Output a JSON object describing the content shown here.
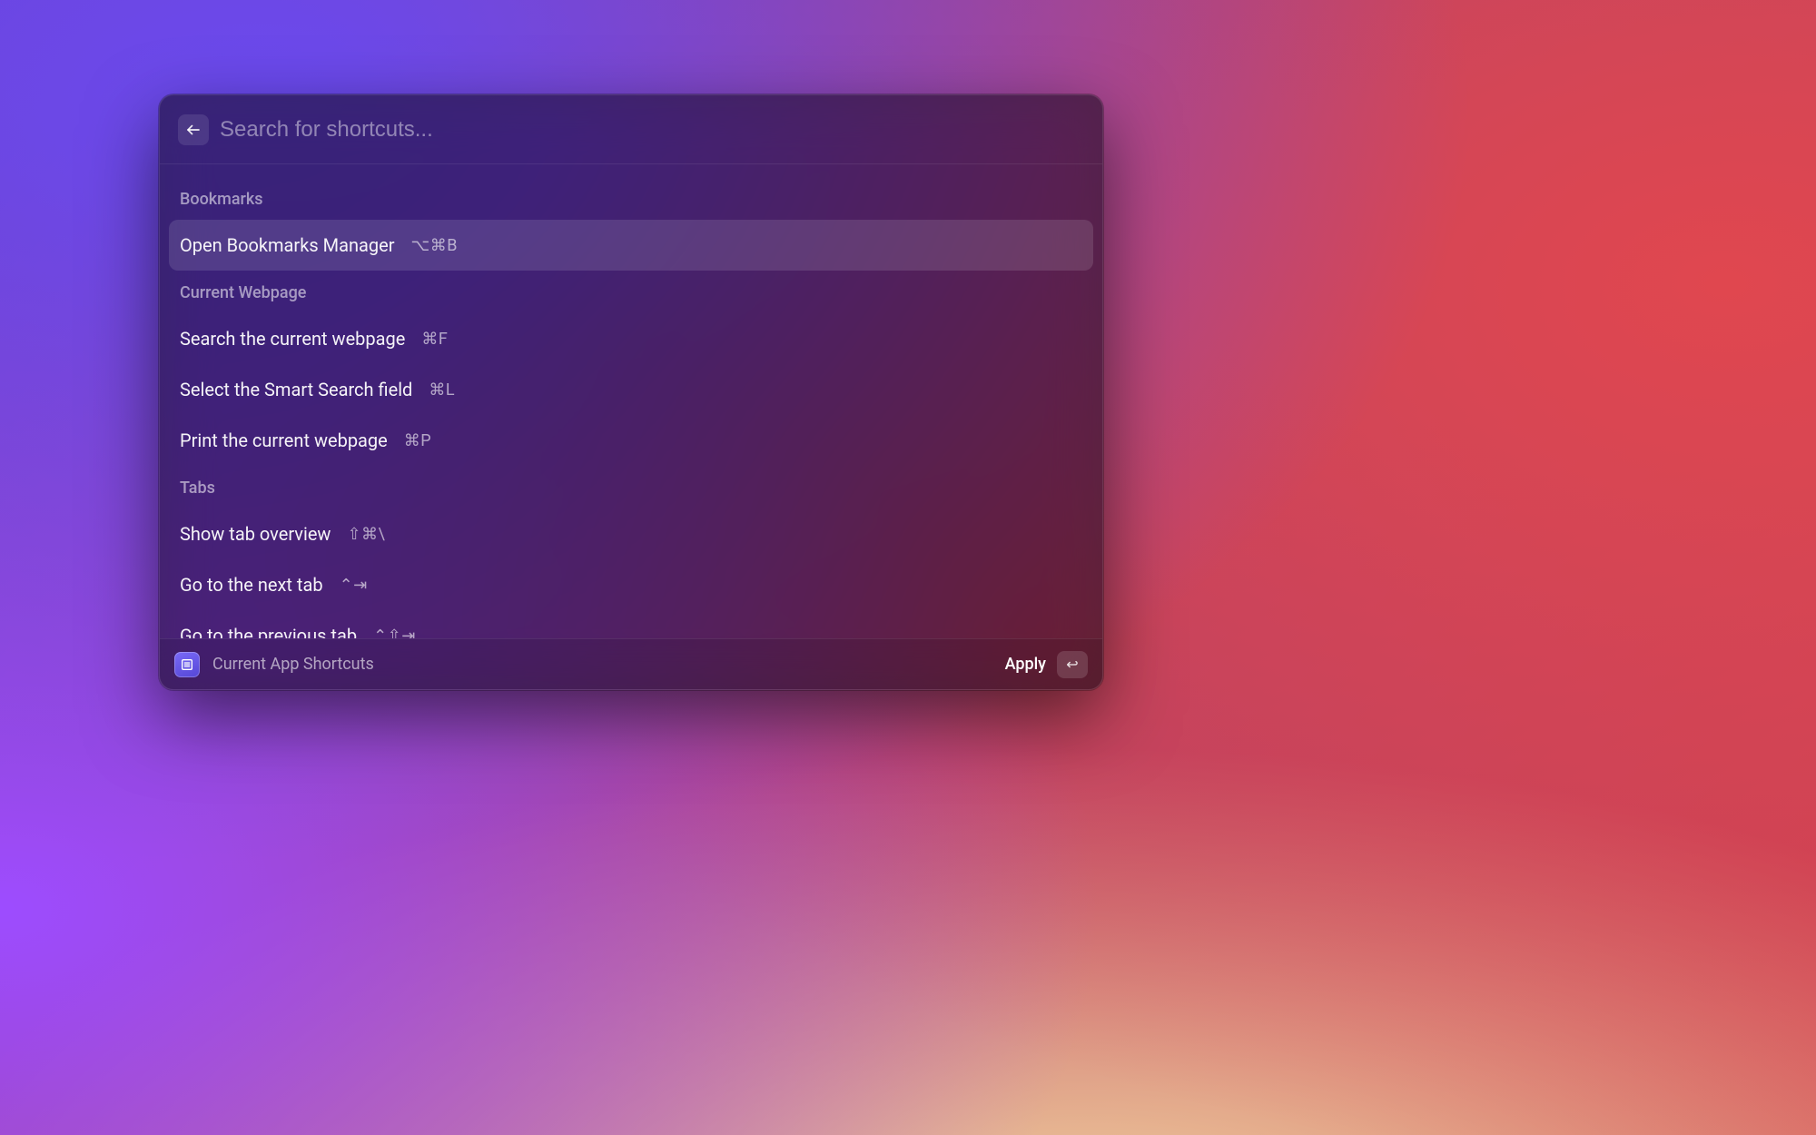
{
  "search": {
    "placeholder": "Search for shortcuts...",
    "value": ""
  },
  "sections": [
    {
      "title": "Bookmarks",
      "items": [
        {
          "label": "Open Bookmarks Manager",
          "shortcut": "⌥⌘B",
          "selected": true
        }
      ]
    },
    {
      "title": "Current Webpage",
      "items": [
        {
          "label": "Search the current webpage",
          "shortcut": "⌘F",
          "selected": false
        },
        {
          "label": "Select the Smart Search field",
          "shortcut": "⌘L",
          "selected": false
        },
        {
          "label": "Print the current webpage",
          "shortcut": "⌘P",
          "selected": false
        }
      ]
    },
    {
      "title": "Tabs",
      "items": [
        {
          "label": "Show tab overview",
          "shortcut": "⇧⌘\\",
          "selected": false
        },
        {
          "label": "Go to the next tab",
          "shortcut": "⌃⇥",
          "selected": false
        },
        {
          "label": "Go to the previous tab",
          "shortcut": "⌃⇧⇥",
          "selected": false
        }
      ]
    }
  ],
  "footer": {
    "context_label": "Current App Shortcuts",
    "action_label": "Apply",
    "action_key_glyph": "↩"
  }
}
